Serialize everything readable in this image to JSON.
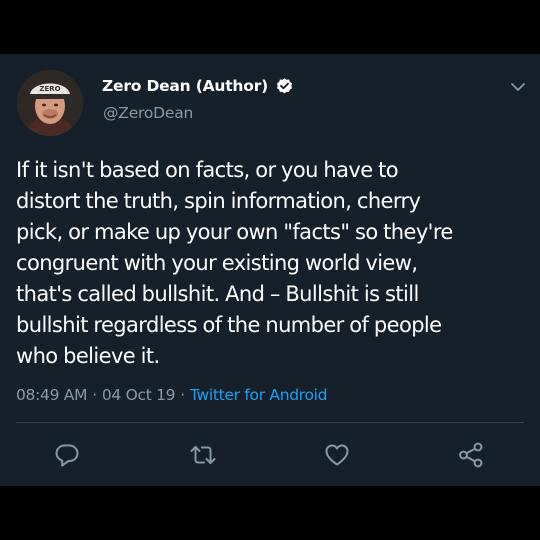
{
  "author": {
    "display_name": "Zero Dean (Author)",
    "handle": "@ZeroDean",
    "verified": true,
    "avatar_icon": "avatar-photo-icon",
    "cap_text": "ZERO"
  },
  "tweet": {
    "lines": [
      "If it isn't based on facts, or you have to",
      "distort the truth, spin information, cherry",
      "pick, or make up your own \"facts\" so they're",
      "congruent with your existing world view,",
      "that's called bullshit. And – Bullshit is still",
      "bullshit regardless of the number of people",
      "who believe it."
    ]
  },
  "meta": {
    "time": "08:49 AM",
    "date": "04 Oct 19",
    "separator": "·",
    "source": "Twitter for Android"
  },
  "actions": [
    {
      "name": "reply",
      "icon": "reply-icon"
    },
    {
      "name": "retweet",
      "icon": "retweet-icon"
    },
    {
      "name": "like",
      "icon": "heart-icon"
    },
    {
      "name": "share",
      "icon": "share-icon"
    }
  ],
  "colors": {
    "background": "#15202b",
    "outer_background": "#000000",
    "text_primary": "#ffffff",
    "text_secondary": "#8899a6",
    "accent": "#1da1f2",
    "divider": "#38444d",
    "icon": "#8899a6"
  }
}
